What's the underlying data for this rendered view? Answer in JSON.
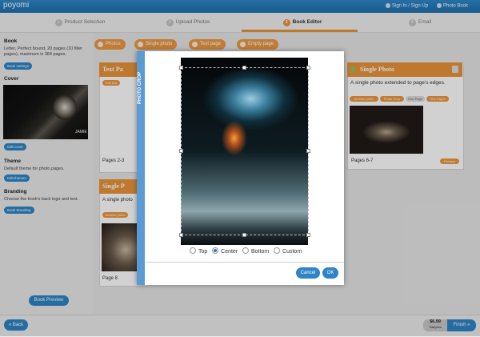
{
  "app": {
    "logo": "poyomi"
  },
  "header": {
    "sign_in": "Sign In / Sign Up",
    "menu": "Photo Book"
  },
  "steps": [
    {
      "num": "1",
      "label": "Product Selection"
    },
    {
      "num": "2",
      "label": "Upload Photos"
    },
    {
      "num": "3",
      "label": "Book Editor"
    },
    {
      "num": "4",
      "label": "Email"
    }
  ],
  "sidebar": {
    "book": {
      "title": "Book",
      "desc": "Letter, Perfect bound, 20 pages (10 filler pages), maximum is 384 pages.",
      "button": "Book settings"
    },
    "cover": {
      "title": "Cover",
      "button": "Edit cover",
      "cover_text": "JAMIE"
    },
    "theme": {
      "title": "Theme",
      "desc": "Default theme for photo pages.",
      "button": "Edit themes"
    },
    "branding": {
      "title": "Branding",
      "desc": "Choose the book's back logo and text.",
      "button": "Book Branding"
    },
    "preview": "Book Preview"
  },
  "toolbar": {
    "photos": "Photos",
    "single_photo": "Single photo",
    "text_page": "Text page",
    "empty_page": "Empty page"
  },
  "cards": {
    "text_page": {
      "title": "Text Pa",
      "button": "Edit text",
      "caption": "Pages 2-3"
    },
    "single_photo_1": {
      "title": "Single P",
      "desc": "A single photo",
      "btn": "Another photo",
      "caption": "Page 8"
    },
    "single_photo_2": {
      "title": "Single Photo",
      "desc": "A single photo extended to page's edges.",
      "b1": "Another photo",
      "b2": "Photo Crop",
      "b3": "One Page",
      "b4": "Text Pages",
      "caption": "Pages 6-7",
      "preview": "Preview"
    }
  },
  "modal": {
    "side_label": "PHOTO CROP",
    "options": [
      "Top",
      "Center",
      "Bottom",
      "Custom"
    ],
    "selected": "Center",
    "cancel": "Cancel",
    "ok": "OK"
  },
  "footer": {
    "back": "« Back",
    "price": "$6.99",
    "price_sub": "Total price",
    "finish": "Finish »"
  },
  "colors": {
    "accent_blue": "#2e84c6",
    "accent_orange": "#e8943a"
  }
}
